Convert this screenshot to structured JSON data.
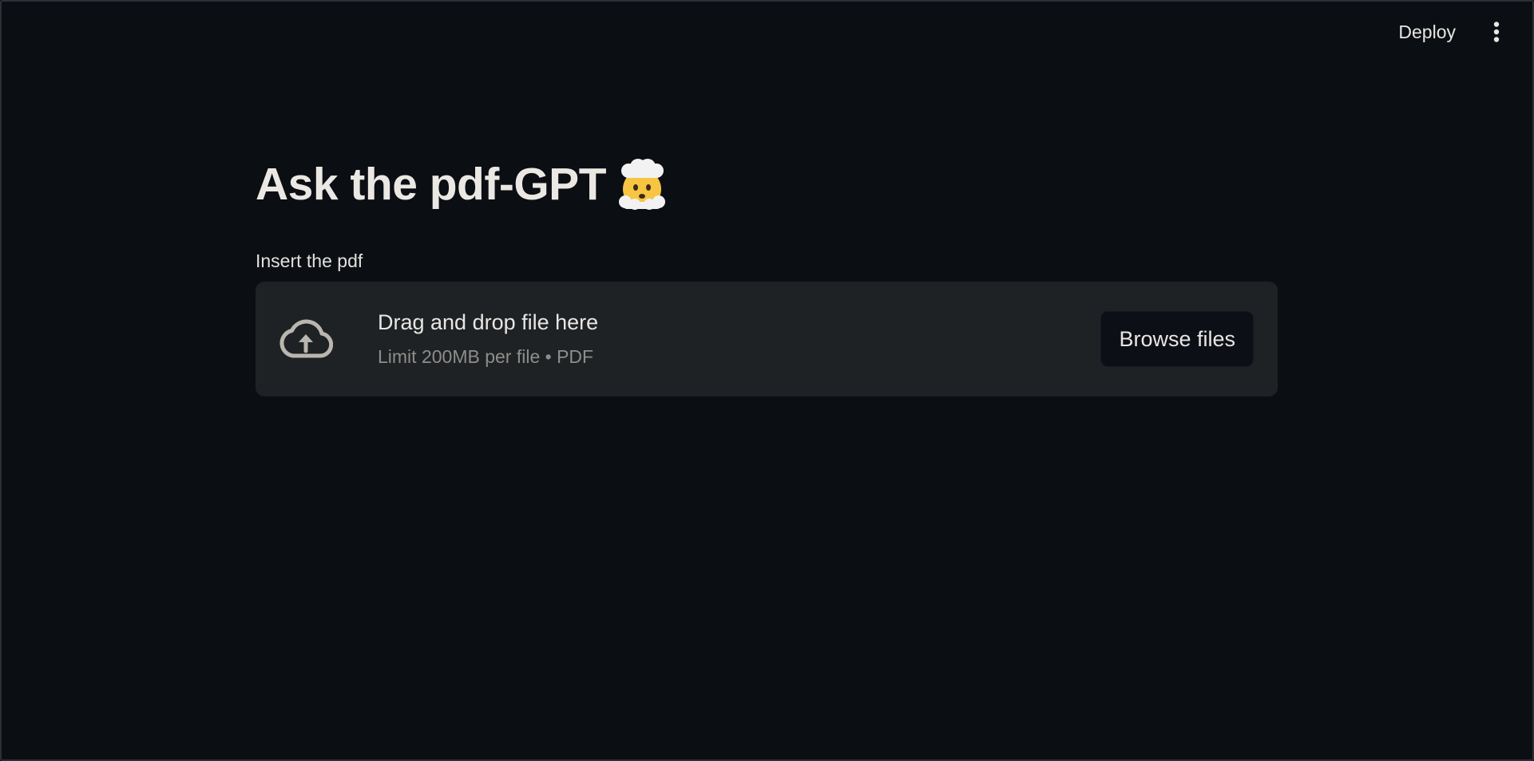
{
  "header": {
    "deploy_label": "Deploy",
    "menu_icon": "kebab-menu-icon"
  },
  "main": {
    "title": "Ask the pdf-GPT",
    "title_emoji": "exploding-head-emoji",
    "uploader": {
      "label": "Insert the pdf",
      "icon": "cloud-upload-icon",
      "drop_text": "Drag and drop file here",
      "limit_text": "Limit 200MB per file • PDF",
      "browse_label": "Browse files"
    }
  },
  "colors": {
    "background": "#0b0e13",
    "dropzone": "#1f2224",
    "button": "#0c0f16",
    "text": "#e8e6e3",
    "muted_text": "#8e8d8a"
  }
}
